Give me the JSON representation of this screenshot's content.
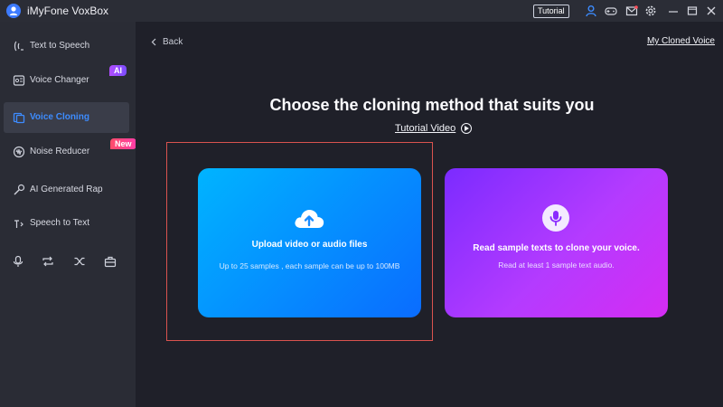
{
  "window": {
    "title": "iMyFone VoxBox",
    "tutorial_label": "Tutorial"
  },
  "sidebar": {
    "items": [
      {
        "label": "Text to Speech",
        "icon": "text-to-speech-icon"
      },
      {
        "label": "Voice Changer",
        "icon": "voice-changer-icon",
        "badge": "AI"
      },
      {
        "label": "Voice Cloning",
        "icon": "voice-cloning-icon",
        "active": true
      },
      {
        "label": "Noise Reducer",
        "icon": "noise-reducer-icon",
        "badge": "New"
      },
      {
        "label": "AI Generated Rap",
        "icon": "rap-icon"
      },
      {
        "label": "Speech to Text",
        "icon": "speech-to-text-icon"
      }
    ],
    "mini_tools": [
      "microphone-icon",
      "repeat-icon",
      "shuffle-icon",
      "toolbox-icon"
    ]
  },
  "main": {
    "back_label": "Back",
    "cloned_voice_link": "My Cloned Voice",
    "headline": "Choose the cloning method that suits you",
    "tutorial_video_label": "Tutorial Video",
    "cards": [
      {
        "title": "Upload video or audio files",
        "description": "Up to 25 samples , each sample can be up to 100MB",
        "icon": "cloud-upload-icon"
      },
      {
        "title": "Read sample texts to clone your voice.",
        "description": "Read at least 1 sample text audio.",
        "icon": "microphone-icon"
      }
    ]
  },
  "colors": {
    "accent": "#3d8cff",
    "upload_gradient": [
      "#00b4ff",
      "#0a6cff"
    ],
    "read_gradient": [
      "#7b2bff",
      "#d52cf3"
    ],
    "highlight_border": "#d9534f"
  }
}
